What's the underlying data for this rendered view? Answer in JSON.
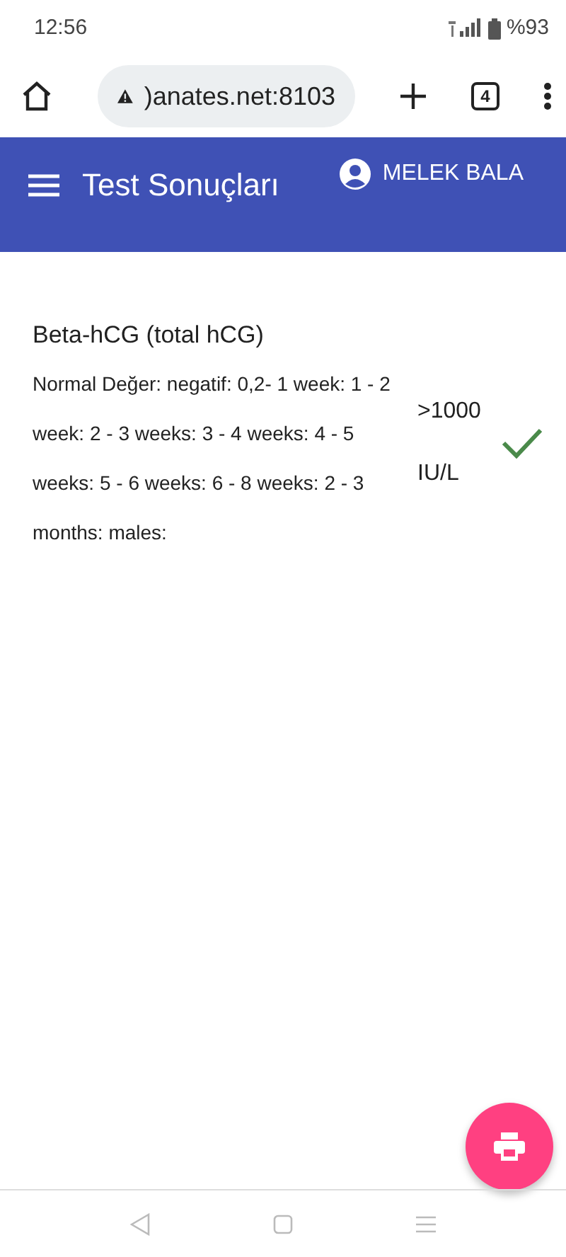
{
  "status_bar": {
    "time": "12:56",
    "battery": "%93"
  },
  "browser": {
    "url": ")anates.net:8103",
    "tab_count": "4"
  },
  "app_bar": {
    "title": "Test Sonuçları",
    "user": "MELEK BALA"
  },
  "result": {
    "name": "Beta-hCG (total hCG)",
    "normal_value": "Normal Değer: negatif: 0,2- 1 week: 1 - 2 week: 2 - 3 weeks: 3 - 4 weeks: 4 - 5 weeks: 5 - 6 weeks: 6 - 8 weeks: 2 - 3 months: males:",
    "value": ">1000",
    "unit": "IU/L",
    "in_range": true
  }
}
